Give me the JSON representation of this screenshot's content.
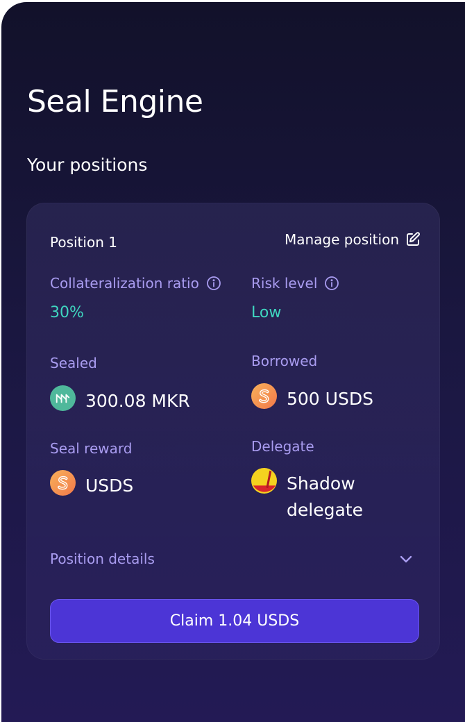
{
  "page": {
    "title": "Seal Engine",
    "section_title": "Your positions"
  },
  "position": {
    "name": "Position 1",
    "manage_label": "Manage position",
    "collateralization": {
      "label": "Collateralization ratio",
      "value": "30%"
    },
    "risk": {
      "label": "Risk level",
      "value": "Low"
    },
    "sealed": {
      "label": "Sealed",
      "value": "300.08 MKR",
      "icon": "mkr-token-icon"
    },
    "borrowed": {
      "label": "Borrowed",
      "value": "500 USDS",
      "icon": "usds-token-icon"
    },
    "seal_reward": {
      "label": "Seal reward",
      "value": "USDS",
      "icon": "usds-token-icon"
    },
    "delegate": {
      "label": "Delegate",
      "value_line1": "Shadow",
      "value_line2": "delegate",
      "icon": "delegate-avatar-icon"
    },
    "details_label": "Position details",
    "claim_label": "Claim 1.04 USDS"
  },
  "colors": {
    "accent_teal": "#3fd6c0",
    "label_purple": "#a99cf0",
    "button_purple": "#4c35d6",
    "mkr_green": "#4fb89b",
    "usds_orange": "#f5924a"
  }
}
